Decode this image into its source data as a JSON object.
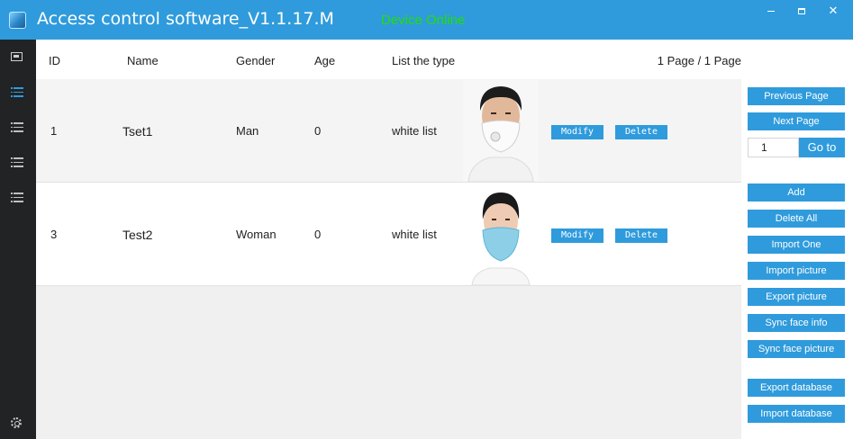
{
  "window": {
    "title": "Access control software_V1.1.17.M",
    "status": "Device Online",
    "status_color": "#22e000",
    "accent_color": "#2f9bdc",
    "minimize_icon": "minimize-icon",
    "maximize_icon": "maximize-icon",
    "close_icon": "close-icon",
    "close_glyph": "✕"
  },
  "sidebar": {
    "items": [
      {
        "icon": "monitor-icon"
      },
      {
        "icon": "list-icon",
        "active": true
      },
      {
        "icon": "list-icon"
      },
      {
        "icon": "list-icon"
      },
      {
        "icon": "list-icon"
      }
    ],
    "settings_icon": "gear-icon"
  },
  "table": {
    "columns": [
      "ID",
      "Name",
      "Gender",
      "Age",
      "List the type"
    ],
    "page_info": "1 Page / 1 Page",
    "rows": [
      {
        "id": "1",
        "name": "Tset1",
        "gender": "Man",
        "age": "0",
        "list_type": "white list",
        "modify_label": "Modify",
        "delete_label": "Delete"
      },
      {
        "id": "3",
        "name": "Test2",
        "gender": "Woman",
        "age": "0",
        "list_type": "white list",
        "modify_label": "Modify",
        "delete_label": "Delete"
      }
    ]
  },
  "pagination": {
    "previous_label": "Previous Page",
    "next_label": "Next Page",
    "page_value": "1",
    "goto_label": "Go to"
  },
  "actions": {
    "add": "Add",
    "delete_all": "Delete All",
    "import_one": "Import One",
    "import_picture": "Import picture",
    "export_picture": "Export picture",
    "sync_face_info": "Sync face info",
    "sync_face_picture": "Sync face picture",
    "export_database": "Export database",
    "import_database": "Import database"
  }
}
